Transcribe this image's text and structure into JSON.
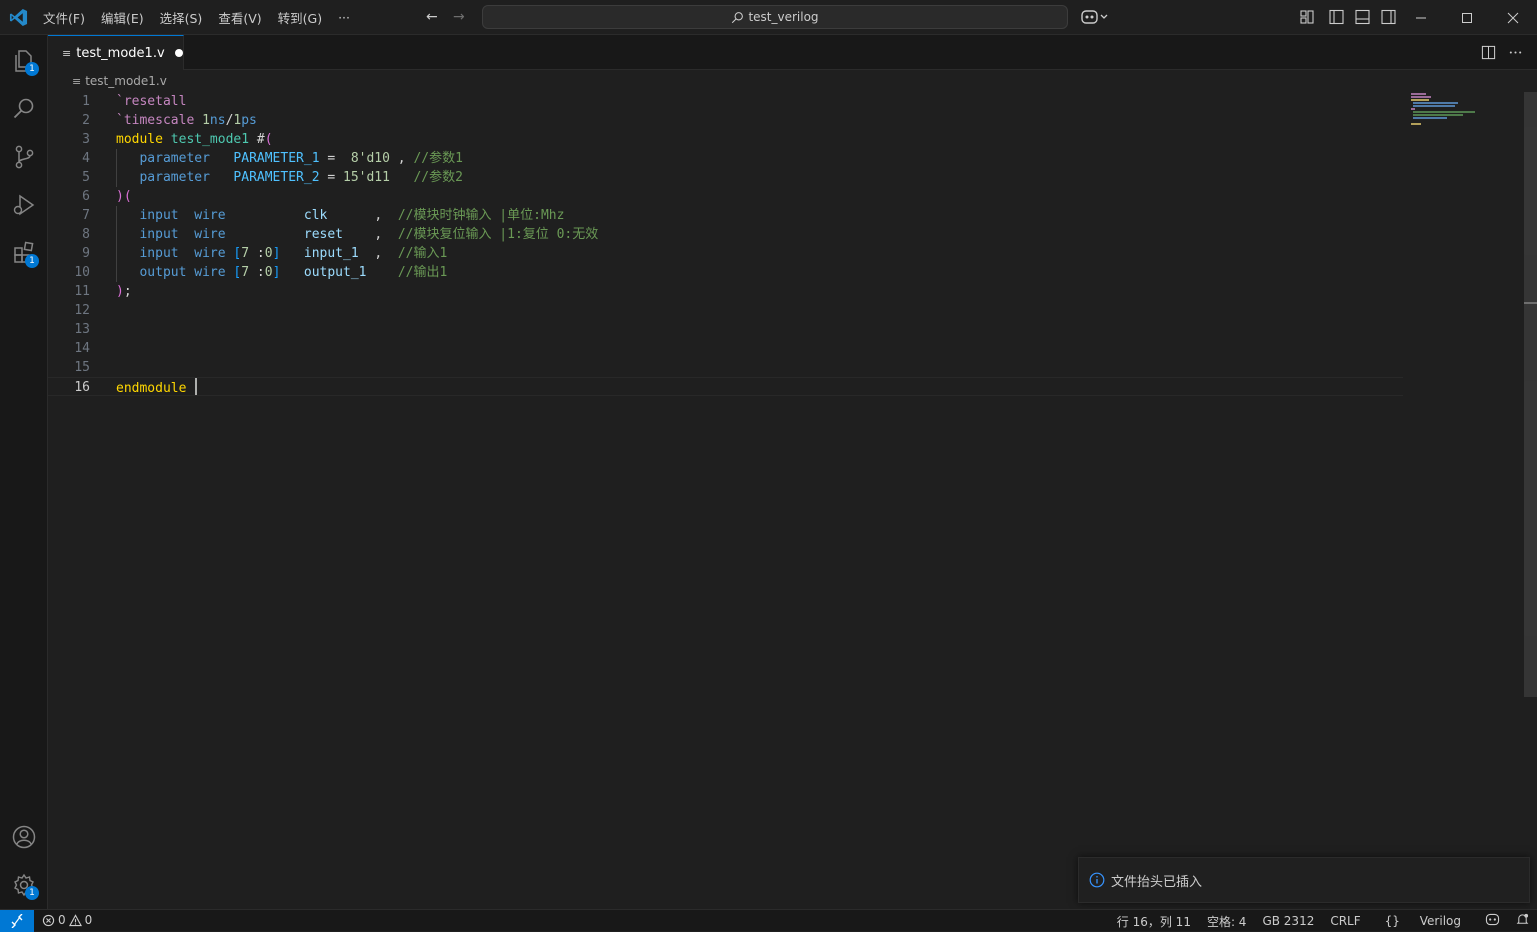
{
  "titlebar": {
    "menu": [
      "文件(F)",
      "编辑(E)",
      "选择(S)",
      "查看(V)",
      "转到(G)",
      "···"
    ],
    "search_text": "test_verilog"
  },
  "activitybar": {
    "explorer_badge": "1",
    "extensions_badge": "1",
    "settings_badge": "1"
  },
  "tab": {
    "filename": "test_mode1.v",
    "file_icon": "≡"
  },
  "breadcrumb": {
    "filename": "test_mode1.v"
  },
  "editor": {
    "line_numbers": [
      "1",
      "2",
      "3",
      "4",
      "5",
      "6",
      "7",
      "8",
      "9",
      "10",
      "11",
      "12",
      "13",
      "14",
      "15",
      "16"
    ],
    "lines": [
      [
        [
          "kw",
          "`resetall"
        ]
      ],
      [
        [
          "kw",
          "`timescale "
        ],
        [
          "nm",
          "1"
        ],
        [
          "kw2",
          "ns"
        ],
        [
          "wh",
          "/"
        ],
        [
          "nm",
          "1"
        ],
        [
          "kw2",
          "ps"
        ]
      ],
      [
        [
          "mod",
          "module "
        ],
        [
          "fn",
          "test_mode1 "
        ],
        [
          "wh",
          "#"
        ],
        [
          "br",
          "("
        ]
      ],
      [
        [
          "wh",
          "   "
        ],
        [
          "kw2",
          "parameter"
        ],
        [
          "wh",
          "   "
        ],
        [
          "pm",
          "PARAMETER_1"
        ],
        [
          "wh",
          " =  "
        ],
        [
          "nm",
          "8'd10"
        ],
        [
          "wh",
          " , "
        ],
        [
          "cm",
          "//参数1"
        ]
      ],
      [
        [
          "wh",
          "   "
        ],
        [
          "kw2",
          "parameter"
        ],
        [
          "wh",
          "   "
        ],
        [
          "pm",
          "PARAMETER_2"
        ],
        [
          "wh",
          " = "
        ],
        [
          "nm",
          "15'd11"
        ],
        [
          "wh",
          "   "
        ],
        [
          "cm",
          "//参数2"
        ]
      ],
      [
        [
          "br",
          ")"
        ],
        [
          "br",
          "("
        ]
      ],
      [
        [
          "wh",
          "   "
        ],
        [
          "kw2",
          "input"
        ],
        [
          "wh",
          "  "
        ],
        [
          "kw2",
          "wire"
        ],
        [
          "wh",
          "          "
        ],
        [
          "id",
          "clk"
        ],
        [
          "wh",
          "      ,  "
        ],
        [
          "cm",
          "//模块时钟输入 |单位:Mhz"
        ]
      ],
      [
        [
          "wh",
          "   "
        ],
        [
          "kw2",
          "input"
        ],
        [
          "wh",
          "  "
        ],
        [
          "kw2",
          "wire"
        ],
        [
          "wh",
          "          "
        ],
        [
          "id",
          "reset"
        ],
        [
          "wh",
          "    ,  "
        ],
        [
          "cm",
          "//模块复位输入 |1:复位 0:无效"
        ]
      ],
      [
        [
          "wh",
          "   "
        ],
        [
          "kw2",
          "input"
        ],
        [
          "wh",
          "  "
        ],
        [
          "kw2",
          "wire"
        ],
        [
          "wh",
          " "
        ],
        [
          "br2",
          "["
        ],
        [
          "nm",
          "7"
        ],
        [
          "wh",
          " :"
        ],
        [
          "nm",
          "0"
        ],
        [
          "br2",
          "]"
        ],
        [
          "wh",
          "   "
        ],
        [
          "id",
          "input_1"
        ],
        [
          "wh",
          "  ,  "
        ],
        [
          "cm",
          "//输入1"
        ]
      ],
      [
        [
          "wh",
          "   "
        ],
        [
          "kw2",
          "output"
        ],
        [
          "wh",
          " "
        ],
        [
          "kw2",
          "wire"
        ],
        [
          "wh",
          " "
        ],
        [
          "br2",
          "["
        ],
        [
          "nm",
          "7"
        ],
        [
          "wh",
          " :"
        ],
        [
          "nm",
          "0"
        ],
        [
          "br2",
          "]"
        ],
        [
          "wh",
          "   "
        ],
        [
          "id",
          "output_1"
        ],
        [
          "wh",
          "    "
        ],
        [
          "cm",
          "//输出1"
        ]
      ],
      [
        [
          "br",
          ")"
        ],
        [
          "wh",
          ";"
        ]
      ],
      [],
      [],
      [],
      [],
      [
        [
          "mod",
          "endmodule "
        ]
      ]
    ]
  },
  "notification": {
    "message": "文件抬头已插入"
  },
  "statusbar": {
    "errors": "0",
    "warnings": "0",
    "position": "行 16，列 11",
    "indent": "空格: 4",
    "encoding": "GB 2312",
    "eol": "CRLF",
    "language": "Verilog",
    "language_icon": "{}"
  },
  "colors": {
    "accent": "#0078d4",
    "background": "#1f1f1f",
    "activitybar": "#181818"
  }
}
